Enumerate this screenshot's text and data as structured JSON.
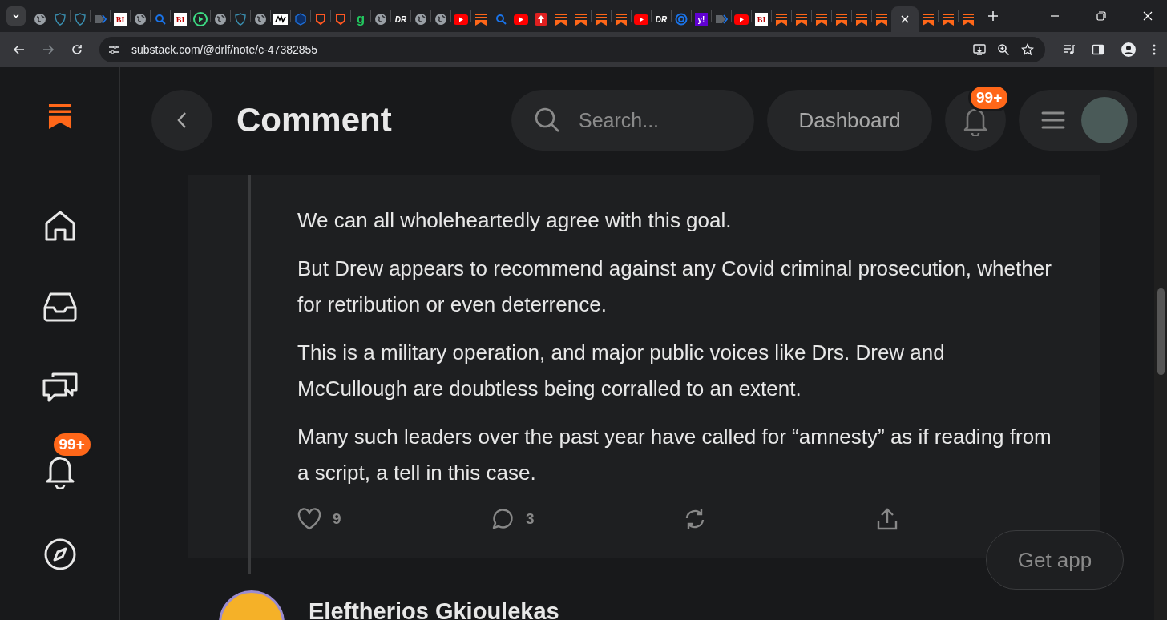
{
  "browser": {
    "tabs": [
      {
        "kind": "globe",
        "selected": false
      },
      {
        "kind": "shield",
        "selected": false
      },
      {
        "kind": "shield",
        "selected": false
      },
      {
        "kind": "tag",
        "selected": false
      },
      {
        "kind": "text",
        "label": "BI",
        "selected": false
      },
      {
        "kind": "globe",
        "selected": false
      },
      {
        "kind": "search",
        "selected": false
      },
      {
        "kind": "text",
        "label": "BI",
        "selected": false
      },
      {
        "kind": "play",
        "selected": false
      },
      {
        "kind": "globe",
        "selected": false
      },
      {
        "kind": "shield",
        "selected": false
      },
      {
        "kind": "globe",
        "selected": false
      },
      {
        "kind": "box",
        "selected": false
      },
      {
        "kind": "cube",
        "selected": false
      },
      {
        "kind": "orange-shield",
        "selected": false
      },
      {
        "kind": "orange-shield",
        "selected": false
      },
      {
        "kind": "letter",
        "label": "g",
        "selected": false
      },
      {
        "kind": "globe",
        "selected": false
      },
      {
        "kind": "italic",
        "label": "DR",
        "selected": false
      },
      {
        "kind": "globe",
        "selected": false
      },
      {
        "kind": "globe",
        "selected": false
      },
      {
        "kind": "youtube",
        "selected": false
      },
      {
        "kind": "substack",
        "selected": false
      },
      {
        "kind": "search",
        "selected": false
      },
      {
        "kind": "youtube",
        "selected": false
      },
      {
        "kind": "pin",
        "selected": false
      },
      {
        "kind": "substack",
        "selected": false
      },
      {
        "kind": "substack",
        "selected": false
      },
      {
        "kind": "substack",
        "selected": false
      },
      {
        "kind": "substack",
        "selected": false
      },
      {
        "kind": "youtube",
        "selected": false
      },
      {
        "kind": "italic",
        "label": "DR",
        "selected": false
      },
      {
        "kind": "ring",
        "selected": false
      },
      {
        "kind": "yahoo",
        "label": "y!",
        "selected": false
      },
      {
        "kind": "tag",
        "selected": false
      },
      {
        "kind": "youtube",
        "selected": false
      },
      {
        "kind": "text",
        "label": "BI",
        "selected": false
      },
      {
        "kind": "substack",
        "selected": false
      },
      {
        "kind": "substack",
        "selected": false
      },
      {
        "kind": "substack",
        "selected": false
      },
      {
        "kind": "substack",
        "selected": false
      },
      {
        "kind": "substack",
        "selected": false
      },
      {
        "kind": "substack",
        "selected": false
      },
      {
        "selected": true
      },
      {
        "kind": "substack",
        "selected": false
      },
      {
        "kind": "substack",
        "selected": false
      },
      {
        "kind": "substack",
        "selected": false
      }
    ],
    "address": "substack.com/@drlf/note/c-47382855"
  },
  "sidebar": {
    "items": [
      {
        "kind": "home"
      },
      {
        "kind": "inbox"
      },
      {
        "kind": "chat"
      },
      {
        "kind": "bell",
        "badge": "99+"
      },
      {
        "kind": "explore"
      }
    ]
  },
  "header": {
    "title": "Comment",
    "search": {
      "placeholder": "Search..."
    },
    "dashboard": "Dashboard",
    "notifications_badge": "99+"
  },
  "comment": {
    "paragraphs": [
      "We can all wholeheartedly agree with this goal.",
      "But Drew appears to recommend against any Covid criminal prosecution, whether for retribution or even deterrence.",
      "This is a military operation, and major public voices like Drs. Drew and McCullough are doubtless being corralled to an extent.",
      "Many such leaders over the past year have called for “amnesty” as if reading from a script, a tell in this case."
    ],
    "actions": [
      {
        "kind": "like",
        "count": "9"
      },
      {
        "kind": "reply",
        "count": "3"
      },
      {
        "kind": "restack"
      },
      {
        "kind": "share"
      }
    ]
  },
  "next_comment": {
    "author": "Eleftherios Gkioulekas"
  },
  "get_app": "Get app"
}
